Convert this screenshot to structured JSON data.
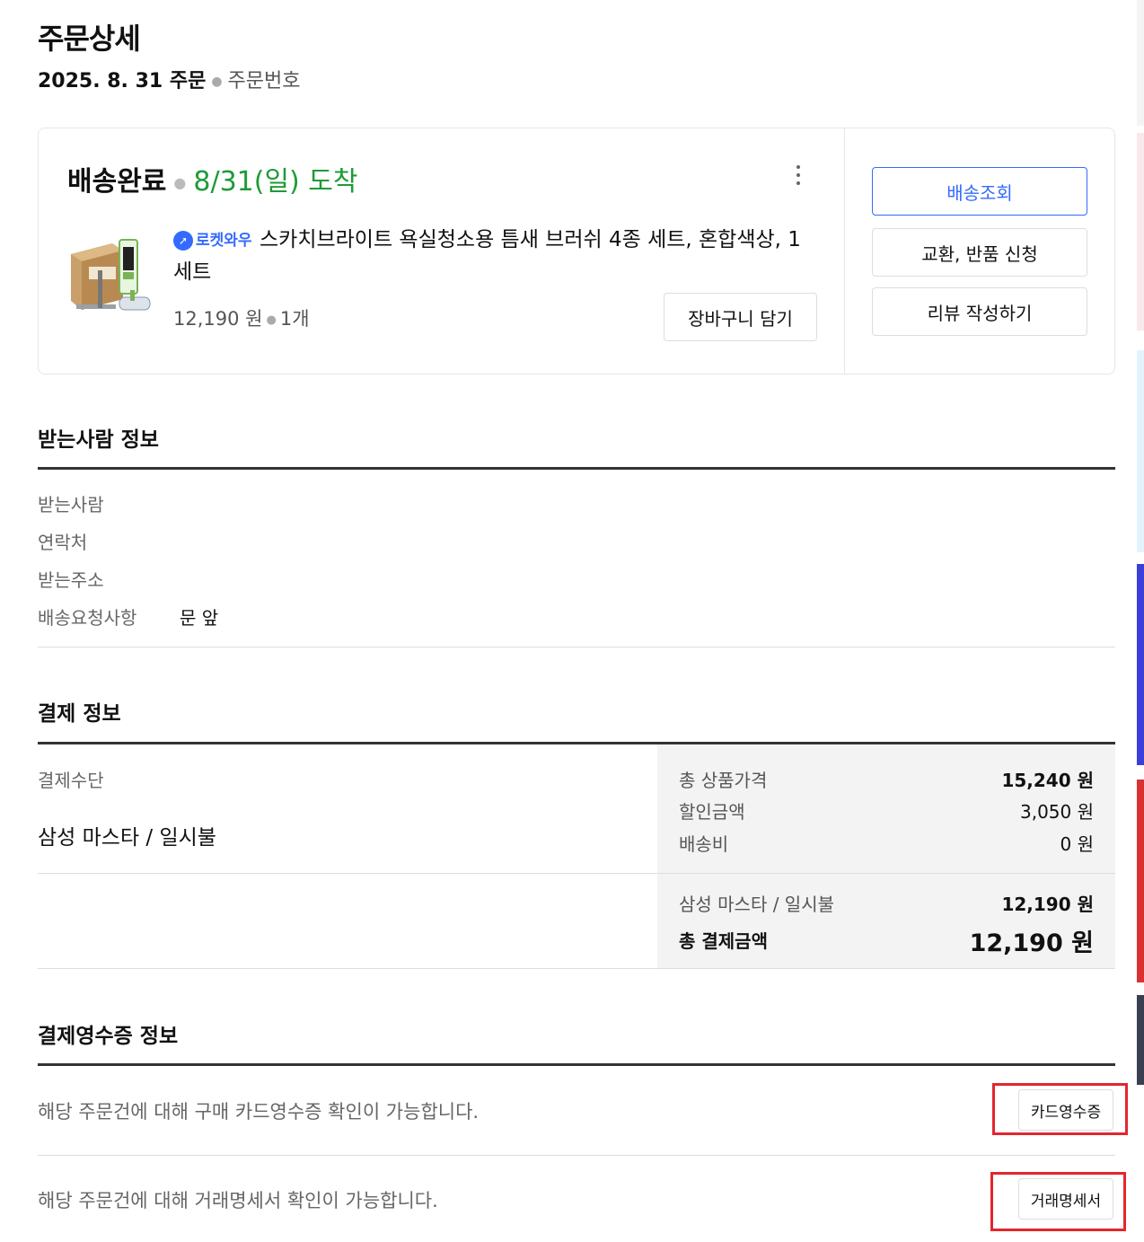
{
  "page": {
    "title": "주문상세",
    "order_date": "2025. 8. 31 주문",
    "order_number_label": "주문번호"
  },
  "order": {
    "status": "배송완료",
    "arrival": "8/31(일) 도착",
    "badge": "로켓와우",
    "product_name": "스카치브라이트 욕실청소용 틈새 브러쉬 4종 세트, 혼합색상, 1세트",
    "price": "12,190 원",
    "quantity": "1개",
    "cart_button": "장바구니 담기"
  },
  "actions": {
    "track": "배송조회",
    "exchange_return": "교환, 반품 신청",
    "review": "리뷰 작성하기"
  },
  "recipient": {
    "section_title": "받는사람 정보",
    "rows": [
      {
        "label": "받는사람",
        "value": ""
      },
      {
        "label": "연락처",
        "value": ""
      },
      {
        "label": "받는주소",
        "value": ""
      },
      {
        "label": "배송요청사항",
        "value": "문 앞"
      }
    ]
  },
  "payment": {
    "section_title": "결제 정보",
    "method_label": "결제수단",
    "method_value": "삼성 마스타 / 일시불",
    "lines": [
      {
        "label": "총 상품가격",
        "amount": "15,240 원"
      },
      {
        "label": "할인금액",
        "amount": "3,050 원"
      },
      {
        "label": "배송비",
        "amount": "0 원"
      }
    ],
    "card_line": {
      "label": "삼성 마스타 / 일시불",
      "amount": "12,190 원"
    },
    "total": {
      "label": "총 결제금액",
      "amount": "12,190 원"
    }
  },
  "receipt": {
    "section_title": "결제영수증 정보",
    "card_receipt_text": "해당 주문건에 대해 구매 카드영수증 확인이 가능합니다.",
    "card_receipt_button": "카드영수증",
    "statement_text": "해당 주문건에 대해 거래명세서 확인이 가능합니다.",
    "statement_button": "거래명세서"
  },
  "colors": {
    "accent_blue": "#346aff",
    "arrival_green": "#1e9b37",
    "highlight_red": "#e3262e"
  }
}
